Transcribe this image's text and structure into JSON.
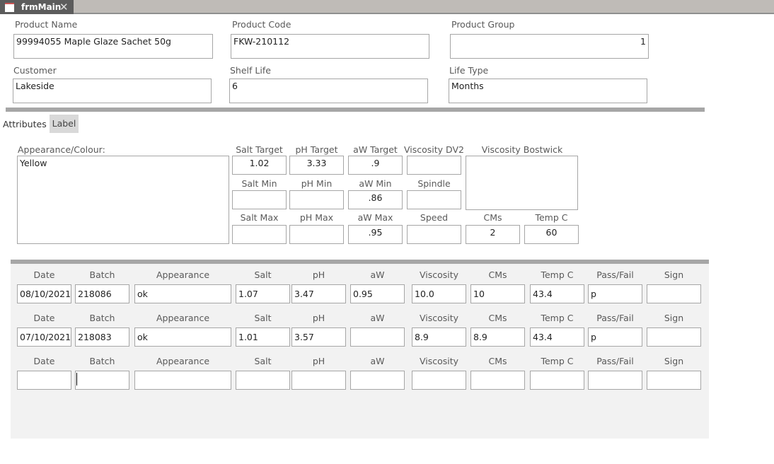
{
  "window": {
    "tab_title": "frmMain",
    "close_icon": "close-icon",
    "form_icon": "form-icon"
  },
  "header": {
    "product_name": {
      "label": "Product Name",
      "value": "99994055 Maple Glaze Sachet 50g"
    },
    "product_code": {
      "label": "Product Code",
      "value": "FKW-210112"
    },
    "product_group": {
      "label": "Product Group",
      "value": "1"
    },
    "customer": {
      "label": "Customer",
      "value": "Lakeside"
    },
    "shelf_life": {
      "label": "Shelf Life",
      "value": "6"
    },
    "life_type": {
      "label": "Life Type",
      "value": "Months"
    }
  },
  "tabs": [
    {
      "label": "Attributes"
    },
    {
      "label": "Label"
    }
  ],
  "attributes": {
    "appearance": {
      "label": "Appearance/Colour:",
      "value": "Yellow"
    },
    "salt_target": {
      "label": "Salt Target",
      "value": "1.02"
    },
    "ph_target": {
      "label": "pH Target",
      "value": "3.33"
    },
    "aw_target": {
      "label": "aW Target",
      "value": ".9"
    },
    "viscosity_dv2": {
      "label": "Viscosity DV2",
      "value": ""
    },
    "viscosity_bostwick": {
      "label": "Viscosity Bostwick",
      "value": ""
    },
    "salt_min": {
      "label": "Salt Min",
      "value": ""
    },
    "ph_min": {
      "label": "pH Min",
      "value": ""
    },
    "aw_min": {
      "label": "aW Min",
      "value": ".86"
    },
    "spindle": {
      "label": "Spindle",
      "value": ""
    },
    "salt_max": {
      "label": "Salt Max",
      "value": ""
    },
    "ph_max": {
      "label": "pH Max",
      "value": ""
    },
    "aw_max": {
      "label": "aW Max",
      "value": ".95"
    },
    "speed": {
      "label": "Speed",
      "value": ""
    },
    "cms": {
      "label": "CMs",
      "value": "2"
    },
    "temp_c": {
      "label": "Temp C",
      "value": "60"
    }
  },
  "results": {
    "columns": [
      "Date",
      "Batch",
      "Appearance",
      "Salt",
      "pH",
      "aW",
      "Viscosity",
      "CMs",
      "Temp C",
      "Pass/Fail",
      "Sign"
    ],
    "rows": [
      [
        "08/10/2021",
        "218086",
        "ok",
        "1.07",
        "3.47",
        "0.95",
        "10.0",
        "10",
        "43.4",
        "p",
        ""
      ],
      [
        "07/10/2021",
        "218083",
        "ok",
        "1.01",
        "3.57",
        "",
        "8.9",
        "8.9",
        "43.4",
        "p",
        ""
      ],
      [
        "",
        "",
        "",
        "",
        "",
        "",
        "",
        "",
        "",
        "",
        ""
      ]
    ]
  }
}
